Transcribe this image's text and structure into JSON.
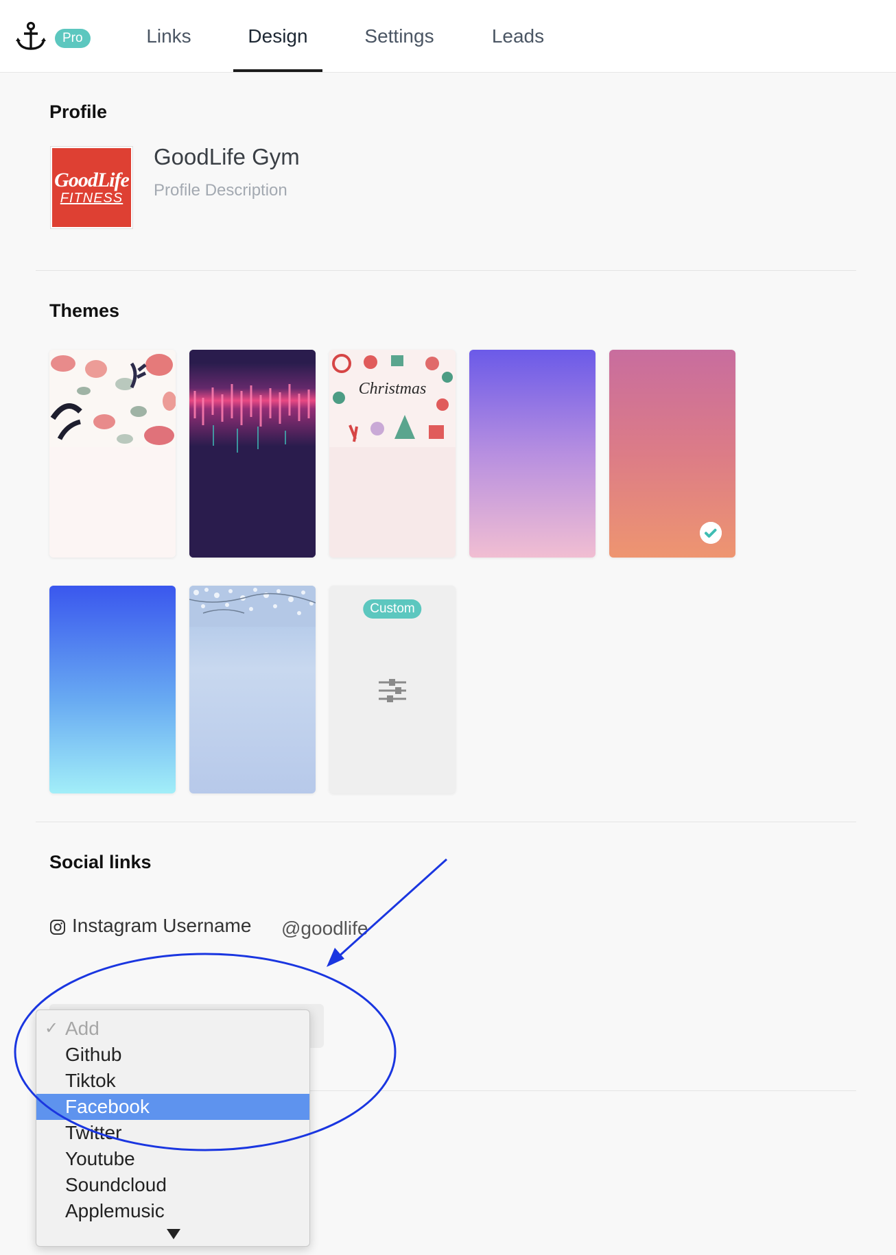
{
  "nav": {
    "logo_icon": "anchor-icon",
    "badge": "Pro",
    "tabs": [
      {
        "label": "Links"
      },
      {
        "label": "Design"
      },
      {
        "label": "Settings"
      },
      {
        "label": "Leads"
      }
    ],
    "active_tab": "Design"
  },
  "profile": {
    "title": "Profile",
    "logo_line1": "GoodLife",
    "logo_line2": "FITNESS",
    "name": "GoodLife Gym",
    "description_placeholder": "Profile Description"
  },
  "themes": {
    "title": "Themes",
    "items": [
      {
        "name": "floral"
      },
      {
        "name": "neon-audio"
      },
      {
        "name": "christmas",
        "image_text": "Christmas"
      },
      {
        "name": "purple-pink-gradient"
      },
      {
        "name": "pink-orange-gradient",
        "selected": true
      },
      {
        "name": "blue-cyan-gradient"
      },
      {
        "name": "snowy-branches"
      },
      {
        "name": "custom",
        "badge": "Custom"
      }
    ],
    "selected_index": 4
  },
  "social": {
    "title": "Social links",
    "instagram_label": "Instagram Username",
    "instagram_value": "@goodlife",
    "dropdown": {
      "options": [
        "Add",
        "Github",
        "Tiktok",
        "Facebook",
        "Twitter",
        "Youtube",
        "Soundcloud",
        "Applemusic"
      ],
      "checked": "Add",
      "highlighted": "Facebook"
    }
  },
  "colors": {
    "accent_teal": "#5cc7bf",
    "highlight_blue": "#5e93ee",
    "annotation_blue": "#1a36e0"
  }
}
